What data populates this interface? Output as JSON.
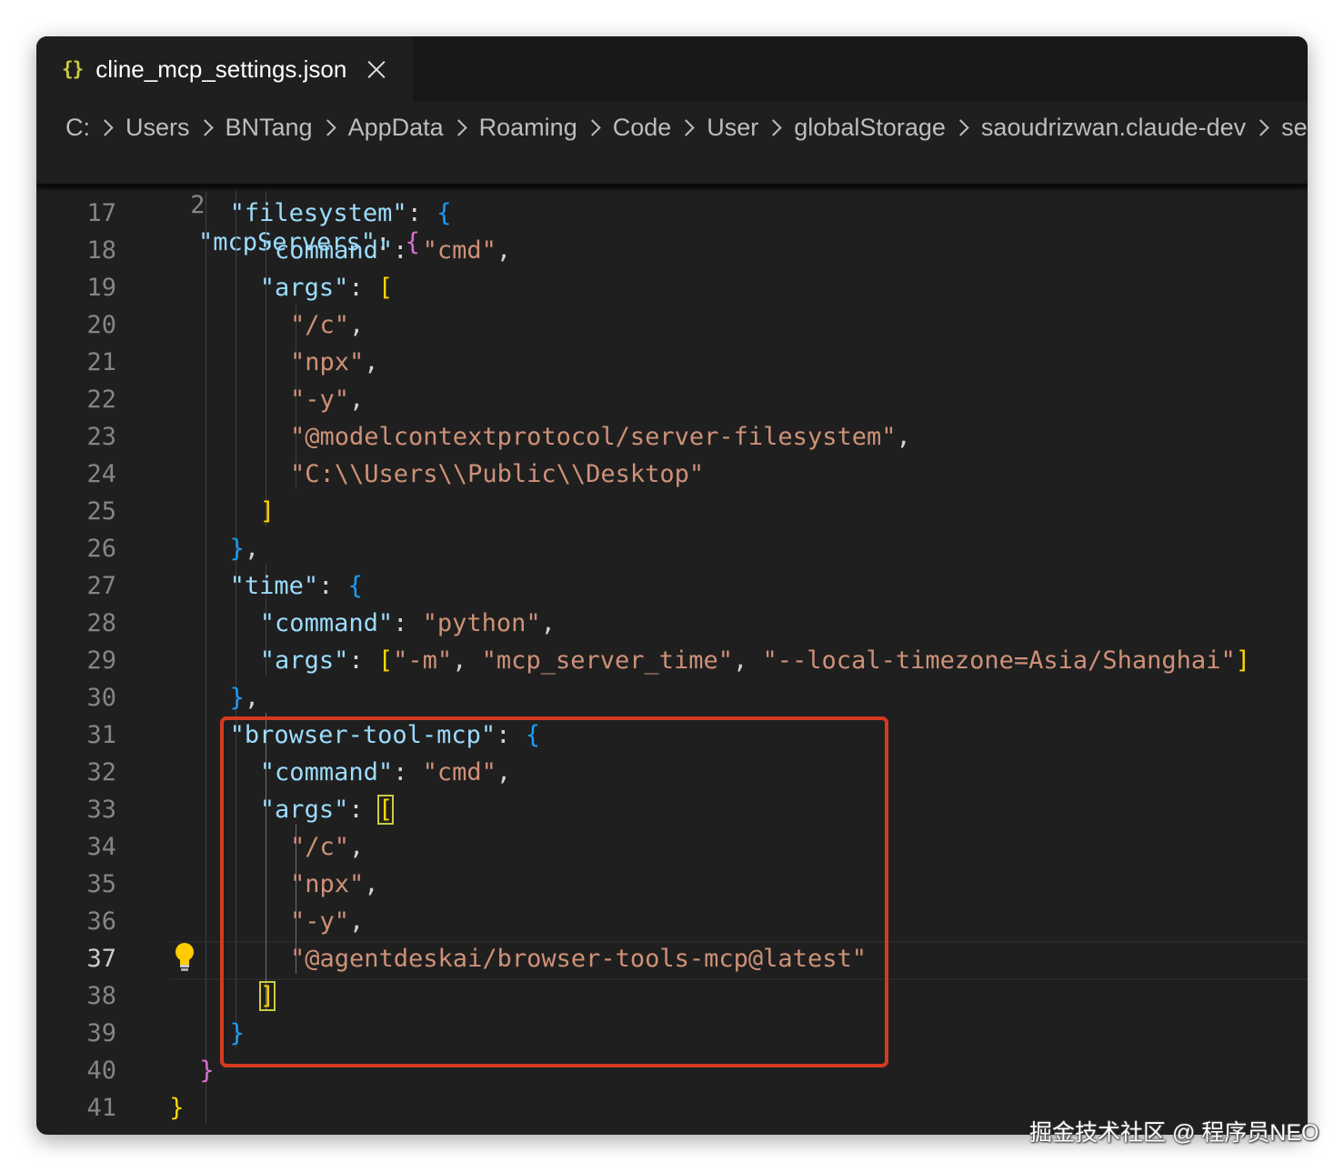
{
  "tab": {
    "icon": "json-braces-icon",
    "label": "cline_mcp_settings.json",
    "icon_text": "{}"
  },
  "breadcrumb": [
    "C:",
    "Users",
    "BNTang",
    "AppData",
    "Roaming",
    "Code",
    "User",
    "globalStorage",
    "saoudrizwan.claude-dev",
    "settings"
  ],
  "sticky": {
    "number": "2",
    "key": "\"mcpServers\"",
    "colon": ": ",
    "brace": "{"
  },
  "lines": [
    {
      "n": "17",
      "tokens": [
        [
          "k",
          "\"filesystem\""
        ],
        [
          "p",
          ": "
        ],
        [
          "b3",
          "{"
        ]
      ]
    },
    {
      "n": "18",
      "tokens": [
        [
          "k",
          "\"command\""
        ],
        [
          "p",
          ": "
        ],
        [
          "s",
          "\"cmd\""
        ],
        [
          "p",
          ","
        ]
      ]
    },
    {
      "n": "19",
      "tokens": [
        [
          "k",
          "\"args\""
        ],
        [
          "p",
          ": "
        ],
        [
          "b1",
          "["
        ]
      ]
    },
    {
      "n": "20",
      "tokens": [
        [
          "s",
          "\"/c\""
        ],
        [
          "p",
          ","
        ]
      ]
    },
    {
      "n": "21",
      "tokens": [
        [
          "s",
          "\"npx\""
        ],
        [
          "p",
          ","
        ]
      ]
    },
    {
      "n": "22",
      "tokens": [
        [
          "s",
          "\"-y\""
        ],
        [
          "p",
          ","
        ]
      ]
    },
    {
      "n": "23",
      "tokens": [
        [
          "s",
          "\"@modelcontextprotocol/server-filesystem\""
        ],
        [
          "p",
          ","
        ]
      ]
    },
    {
      "n": "24",
      "tokens": [
        [
          "s",
          "\"C:\\\\Users\\\\Public\\\\Desktop\""
        ]
      ]
    },
    {
      "n": "25",
      "tokens": [
        [
          "b1",
          "]"
        ]
      ]
    },
    {
      "n": "26",
      "tokens": [
        [
          "b3",
          "}"
        ],
        [
          "p",
          ","
        ]
      ]
    },
    {
      "n": "27",
      "tokens": [
        [
          "k",
          "\"time\""
        ],
        [
          "p",
          ": "
        ],
        [
          "b3",
          "{"
        ]
      ]
    },
    {
      "n": "28",
      "tokens": [
        [
          "k",
          "\"command\""
        ],
        [
          "p",
          ": "
        ],
        [
          "s",
          "\"python\""
        ],
        [
          "p",
          ","
        ]
      ]
    },
    {
      "n": "29",
      "tokens": [
        [
          "k",
          "\"args\""
        ],
        [
          "p",
          ": "
        ],
        [
          "b1",
          "["
        ],
        [
          "s",
          "\"-m\""
        ],
        [
          "p",
          ", "
        ],
        [
          "s",
          "\"mcp_server_time\""
        ],
        [
          "p",
          ", "
        ],
        [
          "s",
          "\"--local-timezone=Asia/Shanghai\""
        ],
        [
          "b1",
          "]"
        ]
      ]
    },
    {
      "n": "30",
      "tokens": [
        [
          "b3",
          "}"
        ],
        [
          "p",
          ","
        ]
      ]
    },
    {
      "n": "31",
      "tokens": [
        [
          "k",
          "\"browser-tool-mcp\""
        ],
        [
          "p",
          ": "
        ],
        [
          "b3",
          "{"
        ]
      ]
    },
    {
      "n": "32",
      "tokens": [
        [
          "k",
          "\"command\""
        ],
        [
          "p",
          ": "
        ],
        [
          "s",
          "\"cmd\""
        ],
        [
          "p",
          ","
        ]
      ]
    },
    {
      "n": "33",
      "tokens": [
        [
          "k",
          "\"args\""
        ],
        [
          "p",
          ": "
        ],
        [
          "b1 bm",
          "["
        ]
      ]
    },
    {
      "n": "34",
      "tokens": [
        [
          "s",
          "\"/c\""
        ],
        [
          "p",
          ","
        ]
      ]
    },
    {
      "n": "35",
      "tokens": [
        [
          "s",
          "\"npx\""
        ],
        [
          "p",
          ","
        ]
      ]
    },
    {
      "n": "36",
      "tokens": [
        [
          "s",
          "\"-y\""
        ],
        [
          "p",
          ","
        ]
      ]
    },
    {
      "n": "37",
      "tokens": [
        [
          "s",
          "\"@agentdeskai/browser-tools-mcp@latest\""
        ]
      ]
    },
    {
      "n": "38",
      "tokens": [
        [
          "b1 bm",
          "]"
        ]
      ]
    },
    {
      "n": "39",
      "tokens": [
        [
          "b3",
          "}"
        ]
      ]
    },
    {
      "n": "40",
      "tokens": [
        [
          "b2",
          "}"
        ]
      ]
    },
    {
      "n": "41",
      "tokens": [
        [
          "b1",
          "}"
        ]
      ]
    }
  ],
  "watermark": "掘金技术社区 @ 程序员NEO",
  "colors": {
    "background": "#1f1f1f",
    "key": "#9cdcfe",
    "string": "#ce9178",
    "highlight_box": "#d53a1f"
  }
}
